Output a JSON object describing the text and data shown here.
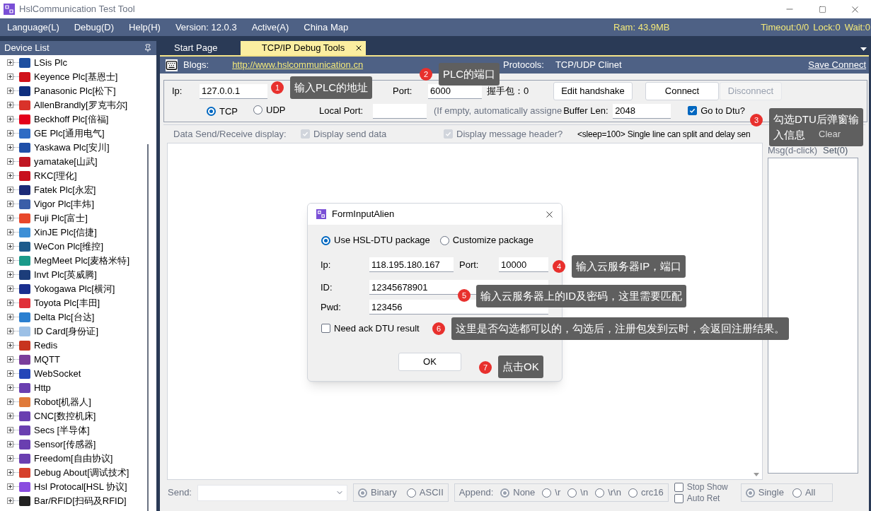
{
  "window": {
    "title": "HslCommunication Test Tool"
  },
  "menu": [
    {
      "label": "Language(L)"
    },
    {
      "label": "Debug(D)"
    },
    {
      "label": "Help(H)"
    },
    {
      "label": "Version: 12.0.3"
    },
    {
      "label": "Active(A)"
    },
    {
      "label": "China Map"
    }
  ],
  "status": {
    "ram": "Ram: 43.9MB",
    "timeout": "Timeout:0/0",
    "lock": "Lock:0",
    "wait": "Wait:0"
  },
  "sidebar": {
    "title": "Device List",
    "items": [
      {
        "label": "LSis Plc",
        "color": "#1d4fa0"
      },
      {
        "label": "Keyence Plc[基恩士]",
        "color": "#d0121b"
      },
      {
        "label": "Panasonic Plc[松下]",
        "color": "#0f2f7f"
      },
      {
        "label": "AllenBrandly[罗克韦尔]",
        "color": "#d9322a"
      },
      {
        "label": "Beckhoff Plc[倍福]",
        "color": "#e3001b"
      },
      {
        "label": "GE Plc[通用电气]",
        "color": "#2f6bc4"
      },
      {
        "label": "Yaskawa Plc[安川]",
        "color": "#1f4fa8"
      },
      {
        "label": "yamatake[山武]",
        "color": "#c01622"
      },
      {
        "label": "RKC[理化]",
        "color": "#c8101e"
      },
      {
        "label": "Fatek Plc[永宏]",
        "color": "#1b2a78"
      },
      {
        "label": "Vigor Plc[丰炜]",
        "color": "#3a5ea8"
      },
      {
        "label": "Fuji Plc[富士]",
        "color": "#e8472b"
      },
      {
        "label": "XinJE Plc[信捷]",
        "color": "#3d8fd6"
      },
      {
        "label": "WeCon Plc[维控]",
        "color": "#1d5b8c"
      },
      {
        "label": "MegMeet Plc[麦格米特]",
        "color": "#1a9a8a"
      },
      {
        "label": "Invt Plc[英威腾]",
        "color": "#1c3d7a"
      },
      {
        "label": "Yokogawa Plc[横河]",
        "color": "#1a2f8f"
      },
      {
        "label": "Toyota Plc[丰田]",
        "color": "#e0303a"
      },
      {
        "label": "Delta Plc[台达]",
        "color": "#2a7fd0"
      },
      {
        "label": "ID Card[身份证]",
        "color": "#9cc0e6"
      },
      {
        "label": "Redis",
        "color": "#c8341f"
      },
      {
        "label": "MQTT",
        "color": "#7a3e9b"
      },
      {
        "label": "WebSocket",
        "color": "#2446b8"
      },
      {
        "label": "Http",
        "color": "#6a3fb0"
      },
      {
        "label": "Robot[机器人]",
        "color": "#e07a3a"
      },
      {
        "label": "CNC[数控机床]",
        "color": "#6a3fb0"
      },
      {
        "label": "Secs [半导体]",
        "color": "#6a3fb0"
      },
      {
        "label": "Sensor[传感器]",
        "color": "#6a3fb0"
      },
      {
        "label": "Freedom[自由协议]",
        "color": "#6a3fb0"
      },
      {
        "label": "Debug About[调试技术]",
        "color": "#d6402c"
      },
      {
        "label": "Hsl Protocal[HSL 协议]",
        "color": "#8a4ce0"
      },
      {
        "label": "Bar/RFID[扫码及RFID]",
        "color": "#222222"
      }
    ]
  },
  "tabs": [
    {
      "label": "Start Page",
      "selected": false
    },
    {
      "label": "TCP/IP Debug Tools",
      "selected": true
    }
  ],
  "blogs": {
    "label": "Blogs:",
    "link": "http://www.hslcommunication.cn",
    "protocols_label": "Protocols:",
    "protocols": "TCP/UDP Clinet",
    "save": "Save Connect"
  },
  "connection": {
    "ip_label": "Ip:",
    "ip": "127.0.0.1",
    "port_label": "Port:",
    "port": "6000",
    "handshake": "握手包：0",
    "edit": "Edit handshake",
    "connect": "Connect",
    "disconnect": {
      "label": "Disconnect",
      "disabled": true
    },
    "modes": [
      {
        "label": "TCP",
        "selected": true
      },
      {
        "label": "UDP",
        "selected": false
      }
    ],
    "local_port_label": "Local Port:",
    "local_port_hint": "(If empty, automatically assigne",
    "buffer_label": "Buffer Len:",
    "buffer": "2048",
    "dtu": {
      "label": "Go to Dtu?",
      "checked": true
    }
  },
  "display": {
    "label": "Data Send/Receive display:",
    "options": [
      {
        "label": "Display send data",
        "checked": true
      },
      {
        "label": "Display message header?",
        "checked": true
      }
    ],
    "hint": "<sleep=100> Single line can split and delay sen",
    "clear": "Clear"
  },
  "messages": {
    "label": "Msg(d-click)",
    "set": "Set(0)"
  },
  "send": {
    "label": "Send:",
    "formats": [
      {
        "label": "Binary",
        "selected": true
      },
      {
        "label": "ASCII",
        "selected": false
      }
    ],
    "append_label": "Append:",
    "append": [
      {
        "label": "None",
        "selected": true
      },
      {
        "label": "\\r",
        "selected": false
      },
      {
        "label": "\\n",
        "selected": false
      },
      {
        "label": "\\r\\n",
        "selected": false
      },
      {
        "label": "crc16",
        "selected": false
      }
    ],
    "options": [
      {
        "label": "Stop Show",
        "checked": false
      },
      {
        "label": "Auto Ret",
        "checked": false
      }
    ],
    "scope": [
      {
        "label": "Single",
        "selected": true
      },
      {
        "label": "All",
        "selected": false
      }
    ]
  },
  "dialog": {
    "title": "FormInputAlien",
    "modes": [
      {
        "label": "Use HSL-DTU package",
        "selected": true
      },
      {
        "label": "Customize package",
        "selected": false
      }
    ],
    "ip_label": "Ip:",
    "ip": "118.195.180.167",
    "port_label": "Port:",
    "port": "10000",
    "id_label": "ID:",
    "id": "12345678901",
    "pwd_label": "Pwd:",
    "pwd": "123456",
    "ack": {
      "label": "Need ack DTU result",
      "checked": false
    },
    "ok": "OK"
  },
  "callouts": [
    {
      "number": "1",
      "text": "输入PLC的地址"
    },
    {
      "number": "2",
      "text": "PLC的端口"
    },
    {
      "number": "3",
      "text": "勾选DTU后弹窗输入信息"
    },
    {
      "number": "4",
      "text": "输入云服务器IP，端口"
    },
    {
      "number": "5",
      "text": "输入云服务器上的ID及密码，这里需要匹配"
    },
    {
      "number": "6",
      "text": "这里是否勾选都可以的，勾选后，注册包发到云时，会返回注册结果。"
    },
    {
      "number": "7",
      "text": "点击OK"
    }
  ]
}
